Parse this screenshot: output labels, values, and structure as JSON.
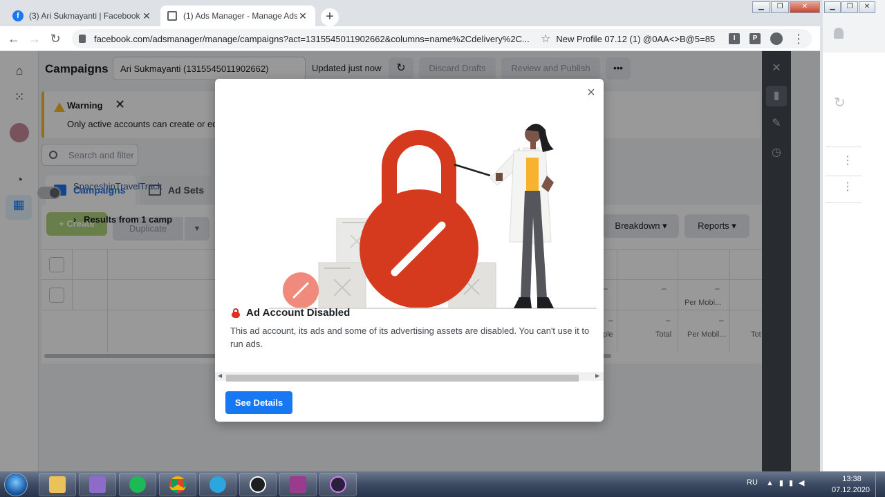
{
  "browser": {
    "tabs": [
      {
        "title": "(3) Ari Sukmayanti | Facebook",
        "favicon": "facebook-icon"
      },
      {
        "title": "(1) Ads Manager - Manage Ads -",
        "favicon": "ads-manager-icon"
      }
    ],
    "url": "facebook.com/adsmanager/manage/campaigns?act=1315545011902662&columns=name%2Cdelivery%2C...",
    "profile_name": "New Profile 07.12 (1) @0AA<>B@5=85",
    "extensions": [
      "I",
      "P"
    ]
  },
  "ads_manager": {
    "page_title": "Campaigns",
    "account_selector": "Ari Sukmayanti (1315545011902662)",
    "updated_text": "Updated just now",
    "discard_drafts": "Discard Drafts",
    "review_publish": "Review and Publish",
    "more": "•••",
    "warning": {
      "title": "Warning",
      "text": "Only active accounts can create or edit"
    },
    "search_placeholder": "Search and filter",
    "tabs": {
      "campaigns": "Campaigns",
      "ad_sets": "Ad Sets"
    },
    "create": "+  Create",
    "duplicate": "Duplicate",
    "breakdown": "Breakdown",
    "reports": "Reports",
    "campaign_name": "SpaceshipTravelTrack",
    "results_row": "Results from 1 camp",
    "dash": "–",
    "metric_labels": [
      "Per Mobi...",
      "ple",
      "Total",
      "Per Mobil...",
      "Tot"
    ]
  },
  "modal": {
    "title": "Ad Account Disabled",
    "body": "This ad account, its ads and some of its advertising assets are disabled. You can't use it to run ads.",
    "button": "See Details",
    "close": "×"
  },
  "taskbar": {
    "language": "RU",
    "time": "13:38",
    "date": "07.12.2020"
  },
  "colors": {
    "fb_blue": "#1877f2",
    "lock_red": "#e0301e",
    "warning_yellow": "#f7b928"
  }
}
